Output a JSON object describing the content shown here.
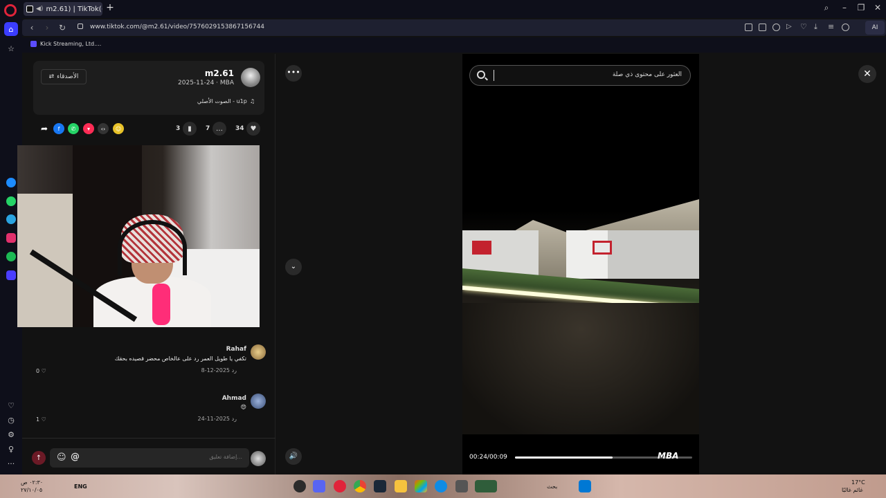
{
  "browser": {
    "tab_title": "m2.61) | TikTok(+99)",
    "url": "www.tiktok.com/@m2.61/video/7576029153867156744",
    "bookmark": "Kick Streaming, Ltd....",
    "ai_label": "AI"
  },
  "post": {
    "follow_label": "الأصدقاء",
    "author_name": "m2.61",
    "date_line": "2025-11-24 · MBA",
    "music": "الصوت الأصلي - u1p",
    "likes": "34",
    "comments": "7",
    "saves": "3"
  },
  "comments": [
    {
      "name": "Rahaf",
      "text": "تكفي يا طويل العمر رد على عالخاص محضر قصيده بحقك",
      "date": "2025-12-8",
      "reply": "رد",
      "likes": "0"
    },
    {
      "name": "Ahmad",
      "text": "😍",
      "date": "2025-11-24",
      "reply": "رد",
      "likes": "1"
    }
  ],
  "comment_input": {
    "placeholder": "إضافة تعليق..."
  },
  "video": {
    "search_text": "العثور على محتوى ذي صلة",
    "time": "00:24/00:09",
    "watermark": "MBA",
    "progress": 0.55
  },
  "taskbar": {
    "temp": "17°C",
    "weather": "غائم غالبًا",
    "lang": "ENG",
    "time": "٠٢:٣٠ ص",
    "date": "٢٧/١٠/٠٥",
    "search": "بحث"
  }
}
